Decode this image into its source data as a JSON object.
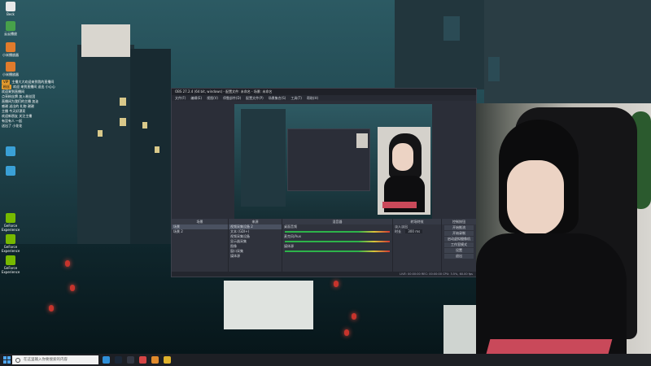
{
  "desktop": {
    "icons": [
      {
        "label": "Beck",
        "color": "#e8e8e8"
      },
      {
        "label": "云云播放",
        "color": "#47a14a"
      },
      {
        "label": "小米播放器",
        "color": "#e07b2c"
      },
      {
        "label": "小米播放器",
        "color": "#e07b2c"
      },
      {
        "label": "",
        "color": "#3aa0d6"
      },
      {
        "label": "",
        "color": "#3aa0d6"
      },
      {
        "label": "GeForce Experience",
        "color": "#76b900"
      },
      {
        "label": "GeForce Experience",
        "color": "#76b900"
      },
      {
        "label": "GeForce Experience",
        "color": "#76b900"
      }
    ],
    "chat_lines": [
      "主播大大欢迎来到我的直播间",
      "欢迎 来到直播间 送出 小心心",
      "欢迎来到直播间",
      "点亮粉丝牌 加入粉丝团",
      "直播间为我们的主播 加油",
      "感谢 送出的 礼物 谢谢",
      "主播 今天好漂亮",
      "欢迎新朋友 关注主播",
      "有没有人 一起",
      "送出了 小花花"
    ],
    "chat_badges": [
      "VIP",
      "粉丝"
    ]
  },
  "obs": {
    "title": "OBS 27.2.4 (64 bit, windows) - 配置文件: 未命名 - 场景: 未命名",
    "menu": [
      "文件(F)",
      "编辑(E)",
      "视图(V)",
      "停靠部件(D)",
      "配置文件(P)",
      "场景集合(S)",
      "工具(T)",
      "帮助(H)"
    ],
    "docks": {
      "scenes": {
        "header": "场景",
        "items": [
          "场景",
          "场景 2"
        ]
      },
      "sources": {
        "header": "来源",
        "items": [
          "视频采集设备 2",
          "文本 (GDI+)",
          "视频采集设备",
          "显示器采集",
          "图像",
          "窗口采集",
          "媒体源"
        ]
      },
      "mixer": {
        "header": "混音器",
        "channels": [
          "桌面音频",
          "麦克风/Aux",
          "媒体源"
        ]
      },
      "transitions": {
        "header": "转场特效",
        "type": "淡入淡出",
        "duration_label": "时长",
        "duration": "300 ms"
      },
      "controls": {
        "header": "控制按钮",
        "buttons": [
          "开始推流",
          "开始录制",
          "启动虚拟摄像机",
          "工作室模式",
          "设置",
          "退出"
        ]
      }
    },
    "status": "LIVE: 00:00:00   REC: 00:00:00   CPU: 3.5%, 60.00 fps"
  },
  "taskbar": {
    "search_placeholder": "在这里输入你要搜索的内容",
    "apps": [
      {
        "name": "edge-icon",
        "color": "#2f8fd8"
      },
      {
        "name": "steam-icon",
        "color": "#1b2838"
      },
      {
        "name": "obs-icon",
        "color": "#333844"
      },
      {
        "name": "app-red-icon",
        "color": "#d64545"
      },
      {
        "name": "app-orange-icon",
        "color": "#e08a2c"
      },
      {
        "name": "app-yellow-icon",
        "color": "#e0b22c"
      }
    ]
  }
}
